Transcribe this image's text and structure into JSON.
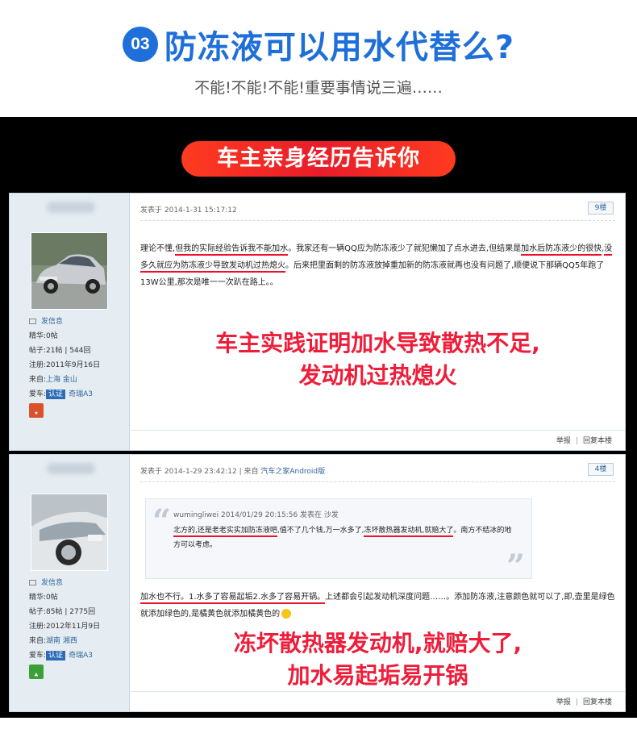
{
  "header": {
    "number": "03",
    "title": "防冻液可以用水代替么?",
    "subtitle": "不能!不能!不能!重要事情说三遍……"
  },
  "banner": {
    "label": "车主亲身经历告诉你"
  },
  "colors": {
    "accent_blue": "#1e6fd9",
    "highlight_red": "#ee1d3a",
    "panel_bg": "#000000"
  },
  "posts": [
    {
      "sidebar": {
        "send_message": "发信息",
        "elite": "精华:0帖",
        "posts": "帖子:21帖 | 544回",
        "registered": "注册:2011年9月16日",
        "from_label": "来自:",
        "from_value": "上海 金山",
        "car_label": "爱车:",
        "car_cert": "认证",
        "car_model": "奇瑞A3",
        "medal_icon": "medal-red-icon"
      },
      "posted_at": "发表于 2014-1-31 15:17:12",
      "floor": "9楼",
      "body": {
        "s1": "理论不懂,",
        "u1": "但我的实际经验告诉我不能加水",
        "s2": "。我家还有一辆QQ应为防冻液少了就犯懒加了点水进去,但结果是",
        "u2": "加水后防冻液少的很快",
        "s3": ",",
        "u3": "没多久就应为防冻液少导致发动机过热熄火",
        "s4": "。后来把里面剩的防冻液放掉重加新的防冻液就再也没有问题了,顺便说下那辆QQ5年跑了13W公里,那次是唯一一次趴在路上。。"
      },
      "callout": [
        "车主实践证明加水导致散热不足,",
        "发动机过热熄火"
      ],
      "footer": {
        "report": "举报",
        "reply": "回复本楼"
      }
    },
    {
      "sidebar": {
        "send_message": "发信息",
        "elite": "精华:0帖",
        "posts": "帖子:85帖 | 2775回",
        "registered": "注册:2012年11月9日",
        "from_label": "来自:",
        "from_value": "湖南 湘西",
        "car_label": "爱车:",
        "car_cert": "认证",
        "car_model": "奇瑞A3",
        "medal_icon": "medal-green-icon"
      },
      "posted_at_prefix": "发表于 2014-1-29 23:42:12 | 来自 ",
      "posted_via": "汽车之家Android版",
      "floor": "4楼",
      "quote": {
        "head": "wumingliwei 2014/01/29 20:15:56 发表在 沙发",
        "u1": "北方的,还是老老实实加防冻液吧",
        "s1": ",值不了几个钱,万一水多了,",
        "u2": "冻坏散热器发动机,就赔大了",
        "s2": "。南方不结冰的地方可以考虑。"
      },
      "body": {
        "u1": "加水也不行。1.水多了容易起垢2.水多了容易开锅。",
        "s1": "上述都会引起发动机深度问题……。添加防冻液,注意颜色就可以了,即,壶里是绿色就添加绿色的,是橘黄色就添加橘黄色的"
      },
      "callout": [
        "冻坏散热器发动机,就赔大了,",
        "加水易起垢易开锅"
      ],
      "footer": {
        "report": "举报",
        "reply": "回复本楼"
      }
    }
  ]
}
